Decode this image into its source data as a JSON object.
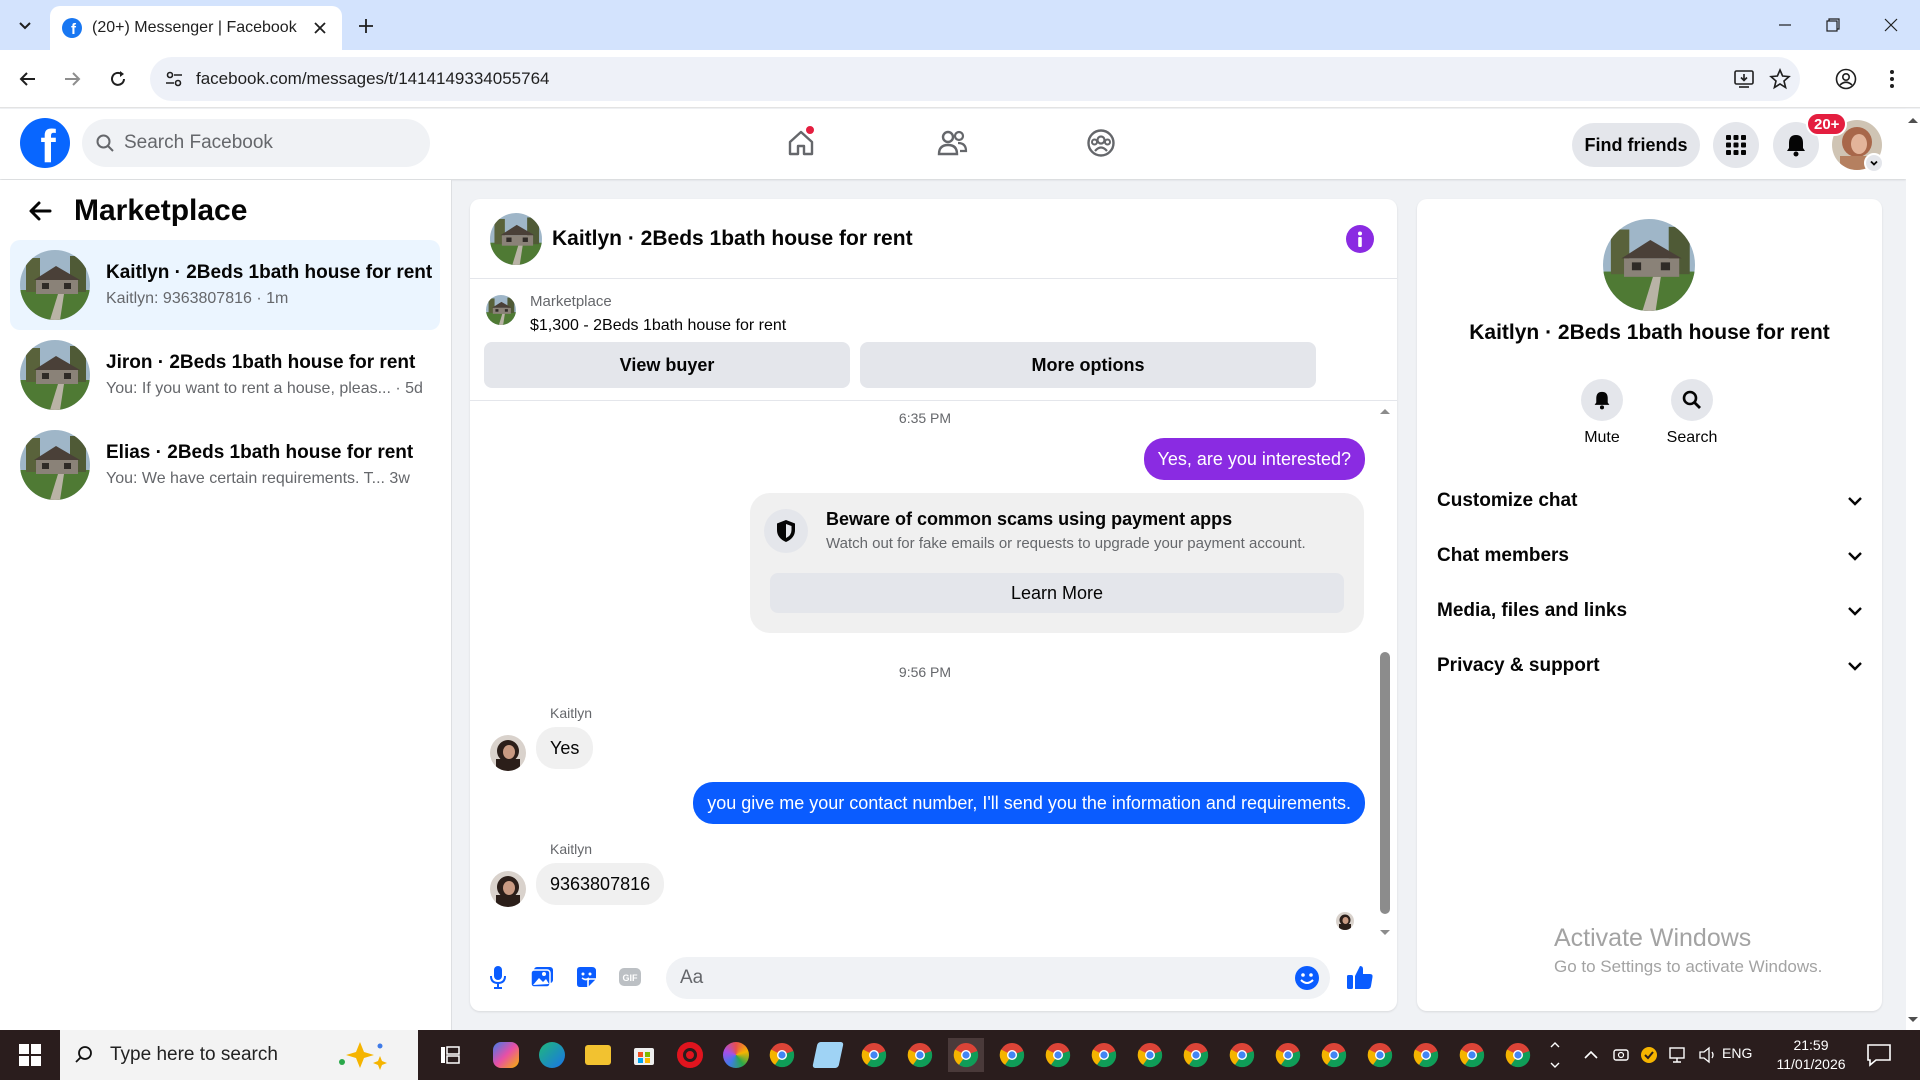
{
  "browser": {
    "tab_title": "(20+) Messenger | Facebook",
    "url": "facebook.com/messages/t/1414149334055764"
  },
  "fb_header": {
    "search_placeholder": "Search Facebook",
    "find_friends": "Find friends",
    "notification_count": "20+"
  },
  "sidebar": {
    "title": "Marketplace",
    "conversations": [
      {
        "name": "Kaitlyn · 2Beds 1bath house for rent",
        "preview": "Kaitlyn: 9363807816 · 1m",
        "active": true
      },
      {
        "name": "Jiron · 2Beds 1bath house for rent",
        "preview": "You: If you want to rent a house, pleas... · 5d",
        "active": false
      },
      {
        "name": "Elias · 2Beds 1bath house for rent",
        "preview": "You: We have certain requirements. T...  3w",
        "active": false
      }
    ]
  },
  "chat": {
    "title": "Kaitlyn · 2Beds 1bath house for rent",
    "marketplace_label": "Marketplace",
    "listing": "$1,300 - 2Beds 1bath house for rent",
    "view_buyer": "View buyer",
    "more_options": "More options",
    "messages": {
      "ts1": "6:35 PM",
      "out1": "Yes, are you interested?",
      "scam_title": "Beware of common scams using payment apps",
      "scam_desc": "Watch out for fake emails or requests to upgrade your payment account.",
      "learn_more": "Learn More",
      "ts2": "9:56 PM",
      "sender1": "Kaitlyn",
      "in1": "Yes",
      "out2": "you give me your contact number, I'll send you the information and requirements.",
      "sender2": "Kaitlyn",
      "in2": "9363807816"
    },
    "composer_placeholder": "Aa"
  },
  "right_panel": {
    "name": "Kaitlyn · 2Beds 1bath house for rent",
    "mute": "Mute",
    "search": "Search",
    "sections": [
      "Customize chat",
      "Chat members",
      "Media, files and links",
      "Privacy & support"
    ]
  },
  "windows": {
    "activate_title": "Activate Windows",
    "activate_sub": "Go to Settings to activate Windows.",
    "search_placeholder": "Type here to search",
    "lang": "ENG",
    "time": "21:59",
    "date": "11/01/2026"
  },
  "colors": {
    "fb_blue": "#0866ff",
    "purple_bubble": "#8a2be2",
    "blue_bubble": "#0a5cff",
    "badge_red": "#e41e3f"
  }
}
